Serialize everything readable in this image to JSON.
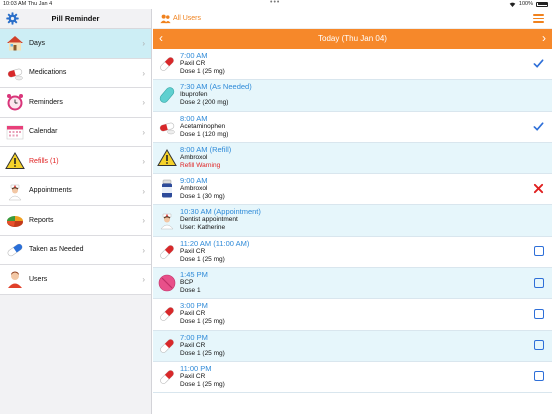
{
  "statusbar": {
    "time": "10:03 AM",
    "date": "Thu Jan 4",
    "battery": "100%"
  },
  "sidebar": {
    "title": "Pill Reminder",
    "items": [
      {
        "label": "Days",
        "icon": "house-icon",
        "active": true
      },
      {
        "label": "Medications",
        "icon": "pill-capsule-icon"
      },
      {
        "label": "Reminders",
        "icon": "alarm-clock-icon"
      },
      {
        "label": "Calendar",
        "icon": "calendar-icon"
      },
      {
        "label": "Refills (1)",
        "icon": "warning-icon",
        "red": true
      },
      {
        "label": "Appointments",
        "icon": "nurse-icon"
      },
      {
        "label": "Reports",
        "icon": "pie-chart-icon"
      },
      {
        "label": "Taken as Needed",
        "icon": "blue-pill-icon"
      },
      {
        "label": "Users",
        "icon": "user-icon"
      }
    ]
  },
  "topbar": {
    "all_users": "All Users"
  },
  "datebar": {
    "title": "Today (Thu Jan 04)"
  },
  "accent": "#f6882a",
  "schedule": [
    {
      "time": "7:00 AM",
      "name": "Paxil CR",
      "dose": "Dose 1 (25 mg)",
      "icon": "red-white-capsule-icon",
      "status": "taken"
    },
    {
      "time": "7:30 AM (As Needed)",
      "name": "Ibuprofen",
      "dose": "Dose 2 (200 mg)",
      "icon": "teal-capsule-icon",
      "status": "none"
    },
    {
      "time": "8:00 AM",
      "name": "Acetaminophen",
      "dose": "Dose 1 (120 mg)",
      "icon": "red-white-pill-icon",
      "status": "taken"
    },
    {
      "time": "8:00 AM (Refill)",
      "name": "Ambroxol",
      "dose": "Refill Warning",
      "icon": "warning-icon",
      "status": "none",
      "dose_red": true
    },
    {
      "time": "9:00 AM",
      "name": "Ambroxol",
      "dose": "Dose 1 (30 mg)",
      "icon": "bottle-icon",
      "status": "missed"
    },
    {
      "time": "10:30 AM (Appointment)",
      "name": "Dentist appointment",
      "dose": "User: Katherine",
      "icon": "nurse-icon",
      "status": "none"
    },
    {
      "time": "11:20 AM (11:00 AM)",
      "name": "Paxil CR",
      "dose": "Dose 1 (25 mg)",
      "icon": "red-white-capsule-icon",
      "status": "pending"
    },
    {
      "time": "1:45 PM",
      "name": "BCP",
      "dose": "Dose 1",
      "icon": "pink-tablet-icon",
      "status": "pending"
    },
    {
      "time": "3:00 PM",
      "name": "Paxil CR",
      "dose": "Dose 1 (25 mg)",
      "icon": "red-white-capsule-icon",
      "status": "pending"
    },
    {
      "time": "7:00 PM",
      "name": "Paxil CR",
      "dose": "Dose 1 (25 mg)",
      "icon": "red-white-capsule-icon",
      "status": "pending"
    },
    {
      "time": "11:00 PM",
      "name": "Paxil CR",
      "dose": "Dose 1 (25 mg)",
      "icon": "red-white-capsule-icon",
      "status": "pending"
    }
  ]
}
